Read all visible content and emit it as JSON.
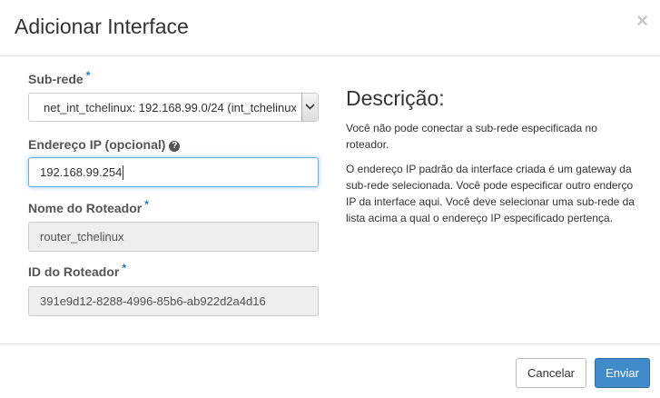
{
  "dialog": {
    "title": "Adicionar Interface",
    "close_glyph": "×"
  },
  "form": {
    "subnet": {
      "label": "Sub-rede",
      "required_marker": "*",
      "selected_value": "net_int_tchelinux: 192.168.99.0/24 (int_tchelinux"
    },
    "ip_address": {
      "label": "Endereço IP (opcional)",
      "help_glyph": "?",
      "value": "192.168.99.254"
    },
    "router_name": {
      "label": "Nome do Roteador",
      "required_marker": "*",
      "value": "router_tchelinux"
    },
    "router_id": {
      "label": "ID do Roteador",
      "required_marker": "*",
      "value": "391e9d12-8288-4996-85b6-ab922d2a4d16"
    }
  },
  "description": {
    "title": "Descrição:",
    "paragraph_1": "Você não pode conectar a sub-rede especificada no roteador.",
    "paragraph_2": "O endereço IP padrão da interface criada é um gateway da sub-rede selecionada. Você pode especificar outro enderço IP da interface aqui. Você deve selecionar uma sub-rede da lista acima a qual o endereço IP especificado pertença."
  },
  "footer": {
    "cancel_label": "Cancelar",
    "submit_label": "Enviar"
  },
  "colors": {
    "primary": "#428bca",
    "required": "#1b75bb",
    "focus_border": "#66afe9"
  },
  "icons": {
    "close": "close-icon",
    "help": "question-circle-icon",
    "dropdown": "chevron-down-icon"
  }
}
